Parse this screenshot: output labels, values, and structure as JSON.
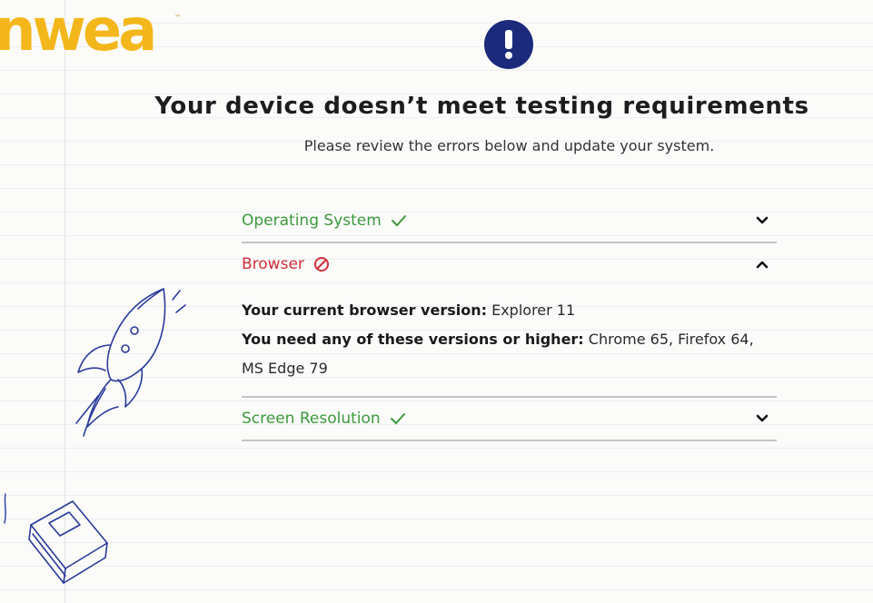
{
  "brand": {
    "logo_text": "nwea",
    "trademark": "™"
  },
  "alert": {
    "icon": "exclamation-icon",
    "glyph": "!"
  },
  "header": {
    "title": "Your device doesn’t meet testing requirements",
    "subtitle": "Please review the errors below and update your system."
  },
  "requirements": [
    {
      "label": "Operating System",
      "status": "pass",
      "expanded": false
    },
    {
      "label": "Browser",
      "status": "fail",
      "expanded": true,
      "details": {
        "current_label": "Your current browser version:",
        "current_value": "Explorer 11",
        "needed_label": "You need any of these versions or higher:",
        "needed_value": "Chrome 65, Firefox 64, MS Edge 79"
      }
    },
    {
      "label": "Screen Resolution",
      "status": "pass",
      "expanded": false
    }
  ],
  "colors": {
    "brand_yellow": "#f3b71b",
    "alert_navy": "#1b2a7a",
    "pass_green": "#3c9a3c",
    "fail_red": "#d0303a"
  }
}
